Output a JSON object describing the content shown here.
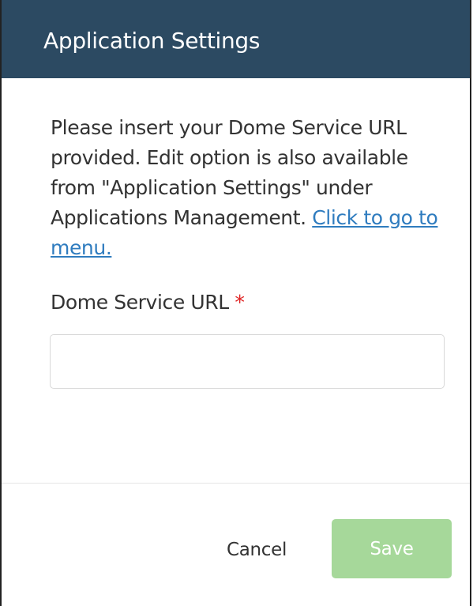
{
  "dialog": {
    "title": "Application Settings",
    "description": "Please insert your Dome Service URL provided. Edit option is also available from \"Application Settings\" under Applications Management.",
    "link_text": "Click to go to menu.",
    "field": {
      "label": "Dome Service URL",
      "required_marker": "*",
      "value": "",
      "placeholder": ""
    },
    "buttons": {
      "cancel_label": "Cancel",
      "save_label": "Save"
    }
  },
  "colors": {
    "header_bg": "#2c4a62",
    "link": "#2f7cbf",
    "required": "#e02424",
    "save_disabled_bg": "#a6d89a"
  }
}
